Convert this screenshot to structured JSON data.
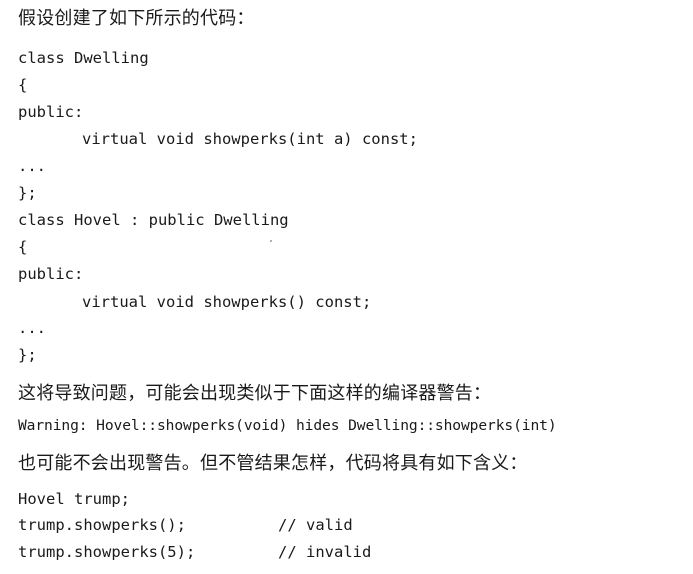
{
  "intro_text": "假设创建了如下所示的代码：",
  "code_block_1": {
    "line1": "class Dwelling",
    "line2": "{",
    "line3": "public:",
    "line4": "virtual void showperks(int a) const;",
    "line5": "...",
    "line6": "};",
    "line7": "class Hovel : public Dwelling",
    "line8": "{",
    "line9": "public:",
    "line10": "virtual void showperks() const;",
    "line11": "...",
    "line12": "};"
  },
  "warning_intro": "这将导致问题，可能会出现类似于下面这样的编译器警告：",
  "warning_line": "Warning: Hovel::showperks(void) hides Dwelling::showperks(int)",
  "result_intro": "也可能不会出现警告。但不管结果怎样，代码将具有如下含义：",
  "code_block_2": {
    "line1": "Hovel trump;",
    "line2_code": "trump.showperks();",
    "line2_comment": "// valid",
    "line3_code": "trump.showperks(5);",
    "line3_comment": "// invalid"
  }
}
